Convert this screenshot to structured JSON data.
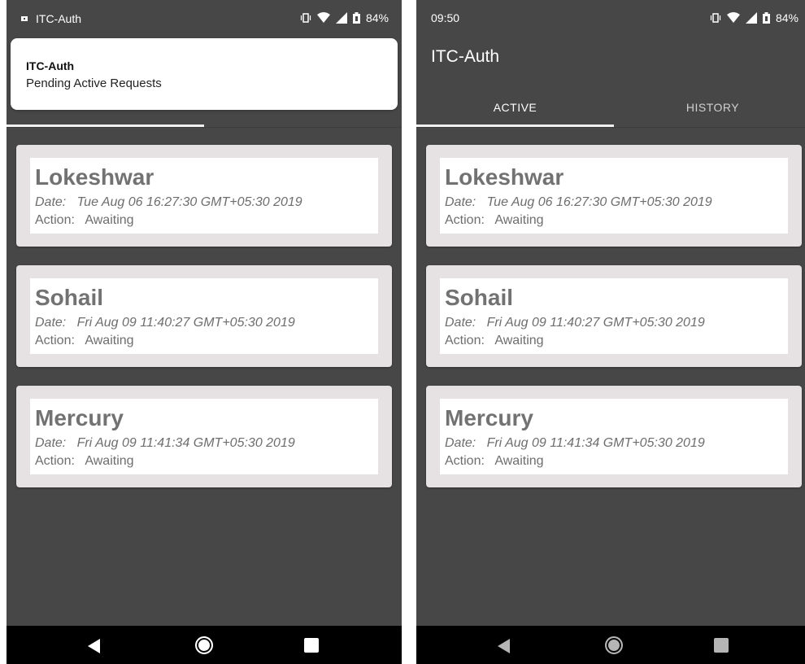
{
  "left": {
    "status": {
      "app_name": "ITC-Auth",
      "battery": "84%"
    },
    "notification": {
      "title": "ITC-Auth",
      "text": "Pending Active Requests"
    }
  },
  "right": {
    "status": {
      "time": "09:50",
      "battery": "84%"
    },
    "app_title": "ITC-Auth",
    "tabs": [
      {
        "label": "ACTIVE"
      },
      {
        "label": "HISTORY"
      }
    ]
  },
  "requests": [
    {
      "name": "Lokeshwar",
      "date": "Date:   Tue Aug 06 16:27:30 GMT+05:30 2019",
      "action": "Action:   Awaiting"
    },
    {
      "name": "Sohail",
      "date": "Date:   Fri Aug 09 11:40:27 GMT+05:30 2019",
      "action": "Action:   Awaiting"
    },
    {
      "name": "Mercury",
      "date": "Date:   Fri Aug 09 11:41:34 GMT+05:30 2019",
      "action": "Action:   Awaiting"
    }
  ],
  "icons": {
    "status": [
      "vibrate-icon",
      "wifi-icon",
      "signal-icon",
      "battery-icon"
    ],
    "nav": [
      "back-icon",
      "home-icon",
      "recents-icon"
    ]
  }
}
